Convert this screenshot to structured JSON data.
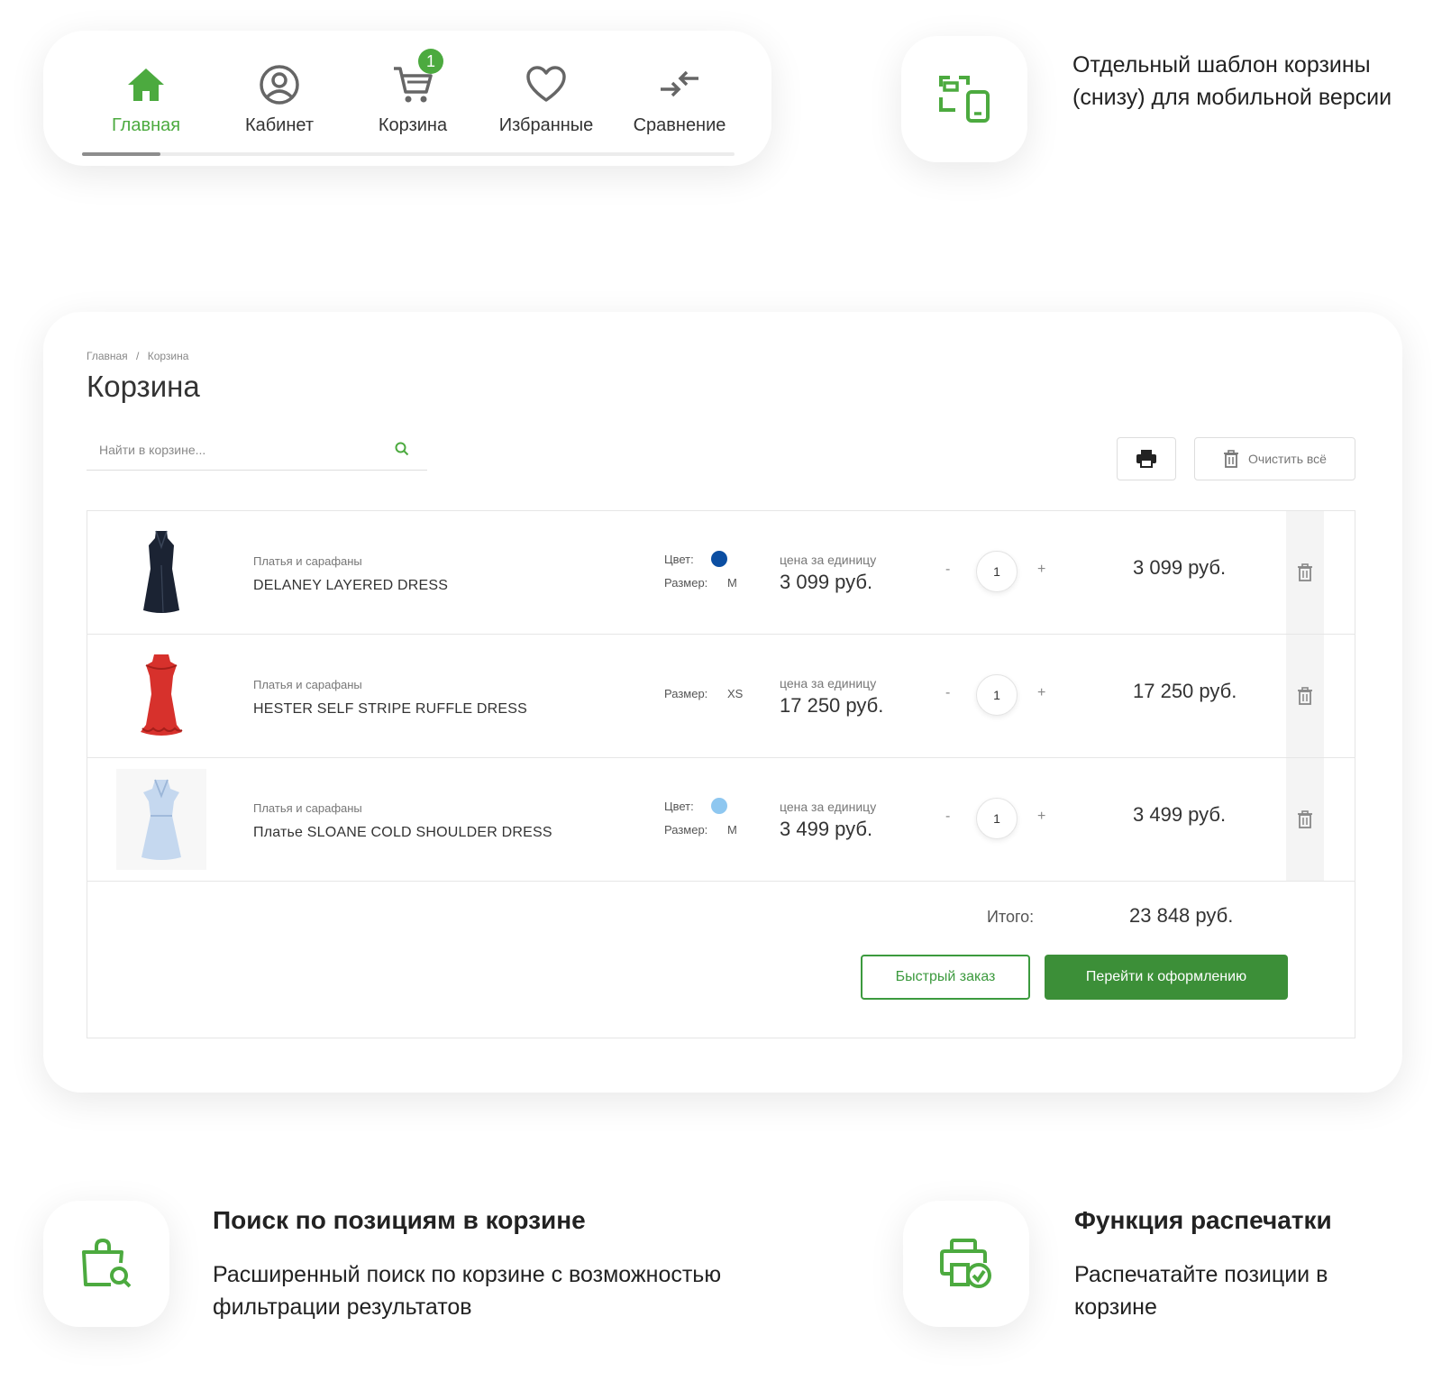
{
  "nav": {
    "items": [
      {
        "label": "Главная",
        "icon": "home-icon",
        "active": true
      },
      {
        "label": "Кабинет",
        "icon": "user-circle-icon",
        "active": false
      },
      {
        "label": "Корзина",
        "icon": "cart-icon",
        "active": false,
        "badge": "1"
      },
      {
        "label": "Избранные",
        "icon": "heart-icon",
        "active": false
      },
      {
        "label": "Сравнение",
        "icon": "compare-icon",
        "active": false
      }
    ],
    "accent": "#4caa3f"
  },
  "features": {
    "mobile_template": "Отдельный шаблон корзины (снизу) для мобильной версии",
    "search_title": "Поиск по позициям в корзине",
    "search_text": "Расширенный поиск по корзине с возможностью фильтрации результатов",
    "print_title": "Функция распечатки",
    "print_text": "Распечатайте позиции в корзине"
  },
  "cart": {
    "breadcrumb": [
      "Главная",
      "/",
      "Корзина"
    ],
    "title": "Корзина",
    "search_placeholder": "Найти в корзине...",
    "clear_label": "Очистить всё",
    "items": [
      {
        "category": "Платья и сарафаны",
        "name": "DELANEY LAYERED DRESS",
        "color_label": "Цвет:",
        "color": "#0b4ea2",
        "size_label": "Размер:",
        "size": "M",
        "unit_label": "цена за единицу",
        "unit_price": "3 099 руб.",
        "minus": "-",
        "qty": "1",
        "plus": "+",
        "total": "3 099 руб.",
        "image": "dress-black"
      },
      {
        "category": "Платья и сарафаны",
        "name": "HESTER SELF STRIPE RUFFLE DRESS",
        "size_label": "Размер:",
        "size": "XS",
        "unit_label": "цена за единицу",
        "unit_price": "17 250 руб.",
        "minus": "-",
        "qty": "1",
        "plus": "+",
        "total": "17 250 руб.",
        "image": "dress-red"
      },
      {
        "category": "Платья и сарафаны",
        "name": "Платье SLOANE COLD SHOULDER DRESS",
        "color_label": "Цвет:",
        "color": "#8ec7f0",
        "size_label": "Размер:",
        "size": "M",
        "unit_label": "цена за единицу",
        "unit_price": "3 499 руб.",
        "minus": "-",
        "qty": "1",
        "plus": "+",
        "total": "3 499 руб.",
        "image": "dress-lightblue"
      }
    ],
    "total_label": "Итого:",
    "total_value": "23 848 руб.",
    "quick_order_label": "Быстрый заказ",
    "checkout_label": "Перейти к оформлению",
    "button_color": "#3c8f38"
  }
}
